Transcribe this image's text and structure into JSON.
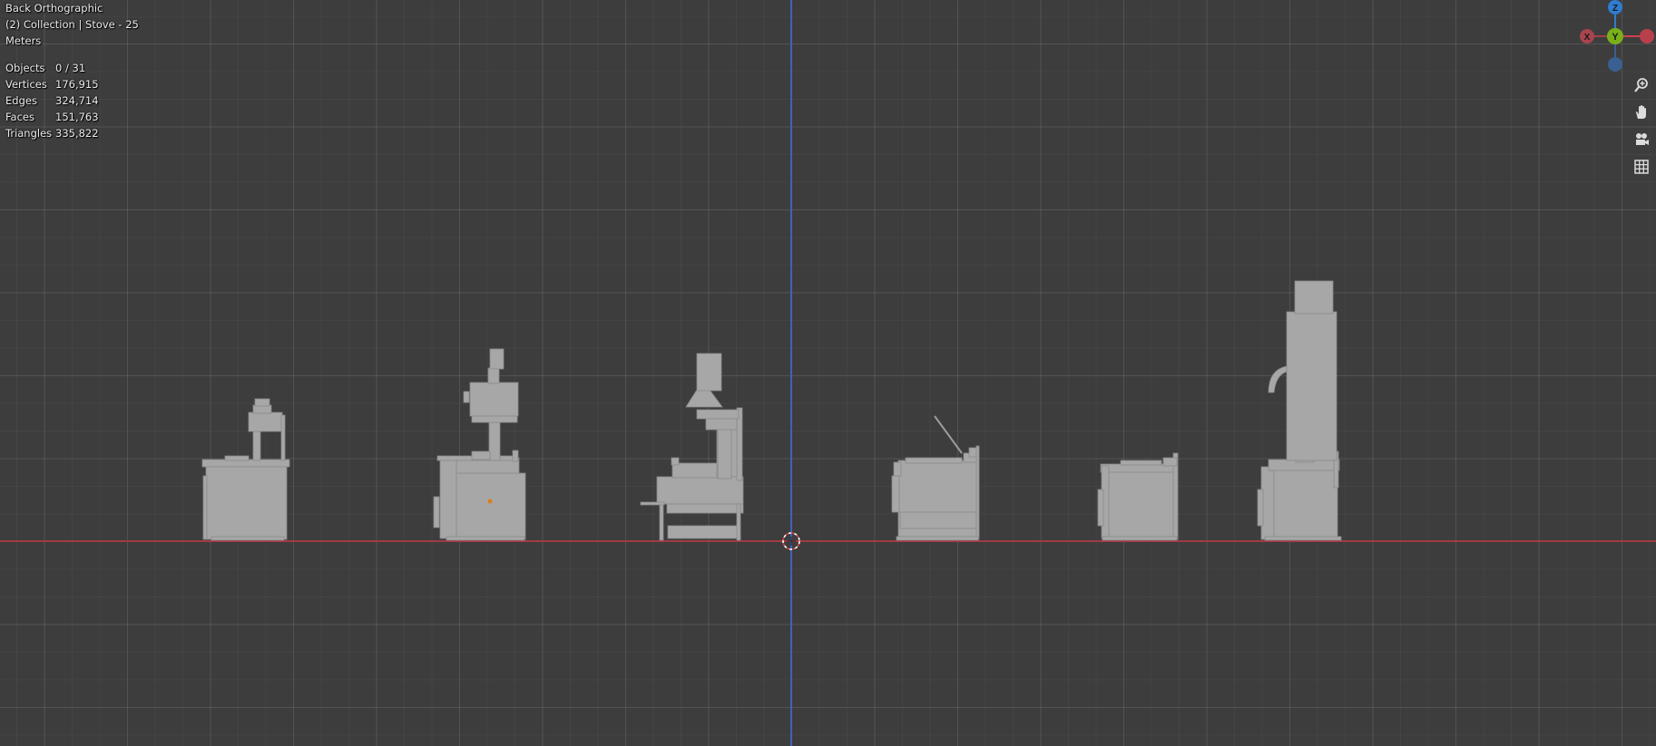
{
  "viewport": {
    "view_name": "Back Orthographic",
    "collection": "(2) Collection | Stove - 25",
    "units": "Meters",
    "stats": [
      {
        "label": "Objects",
        "value": "0 / 31"
      },
      {
        "label": "Vertices",
        "value": "176,915"
      },
      {
        "label": "Edges",
        "value": "324,714"
      },
      {
        "label": "Faces",
        "value": "151,763"
      },
      {
        "label": "Triangles",
        "value": "335,822"
      }
    ]
  },
  "gizmo": {
    "z_label": "Z",
    "y_label": "Y",
    "x_label": "X",
    "colors": {
      "x": "#d1414f",
      "y": "#79b01a",
      "z": "#2f7cd0",
      "neg_z": "#3a5f92"
    }
  },
  "nav_tools": [
    {
      "name": "zoom-icon"
    },
    {
      "name": "hand-pan-icon"
    },
    {
      "name": "camera-view-icon"
    },
    {
      "name": "ortho-grid-icon"
    }
  ],
  "colors": {
    "background": "#3d3d3d",
    "x_axis": "#a23a45",
    "z_axis": "#3f63b3",
    "model": "#a7a7a7"
  }
}
